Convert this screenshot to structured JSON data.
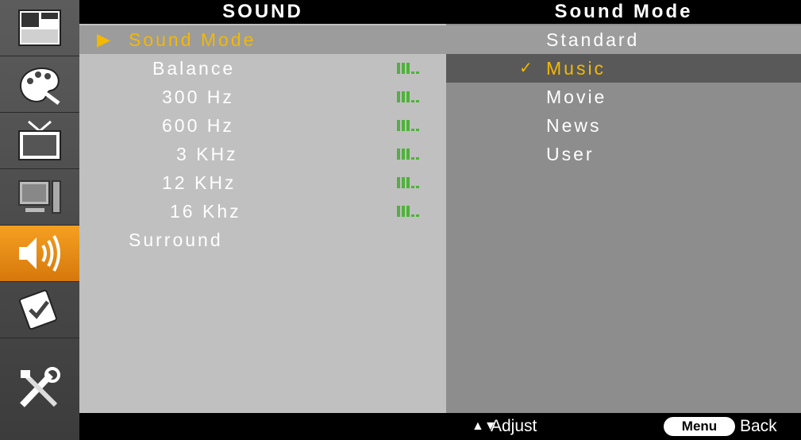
{
  "header": {
    "menu_title": "SOUND",
    "options_title": "Sound Mode"
  },
  "rail": {
    "icons": [
      "picture-layout-icon",
      "palette-icon",
      "tv-icon",
      "pc-monitor-icon",
      "speaker-sound-icon",
      "checklist-icon",
      "tools-icon"
    ],
    "active_index": 4,
    "active_color": "#f29a1f"
  },
  "menu": {
    "items": [
      {
        "label": "Sound Mode"
      },
      {
        "label": "Balance"
      },
      {
        "label": "300 Hz"
      },
      {
        "label": "600 Hz"
      },
      {
        "label": "3 KHz"
      },
      {
        "label": "12 KHz"
      },
      {
        "label": "16 Khz"
      },
      {
        "label": "Surround"
      }
    ],
    "selected_index": 0
  },
  "options": {
    "items": [
      {
        "label": "Standard"
      },
      {
        "label": "Music"
      },
      {
        "label": "Movie"
      },
      {
        "label": "News"
      },
      {
        "label": "User"
      }
    ],
    "checked_index": 1,
    "check_mark": "✓"
  },
  "footer": {
    "adjust_label": "Adjust",
    "menu_key": "Menu",
    "back_label": "Back"
  },
  "colors": {
    "accent": "#f5b800",
    "level": "#4fb23a",
    "menu_bg": "#c0c0c0",
    "options_bg": "#8d8d8d"
  }
}
